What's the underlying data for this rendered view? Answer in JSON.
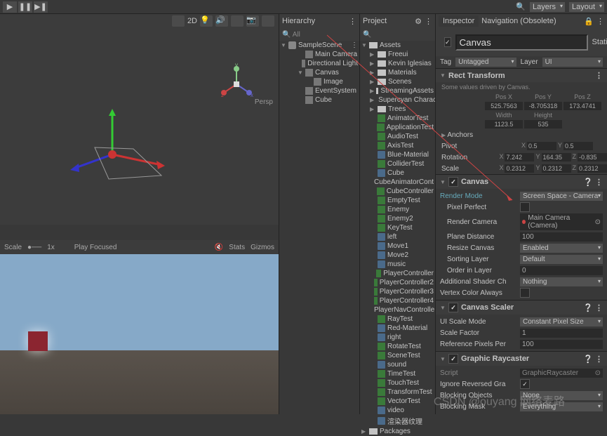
{
  "topbar": {
    "layers": "Layers",
    "layout": "Layout"
  },
  "hierarchy": {
    "title": "Hierarchy",
    "search": "All",
    "scene": "SampleScene",
    "items": [
      {
        "name": "Main Camera",
        "indent": 2
      },
      {
        "name": "Directional Light",
        "indent": 2
      },
      {
        "name": "Canvas",
        "indent": 2,
        "fold": true
      },
      {
        "name": "Image",
        "indent": 3
      },
      {
        "name": "EventSystem",
        "indent": 2
      },
      {
        "name": "Cube",
        "indent": 2
      }
    ]
  },
  "project": {
    "title": "Project",
    "root": "Assets",
    "items": [
      {
        "name": "Freeui",
        "type": "folder"
      },
      {
        "name": "Kevin Iglesias",
        "type": "folder"
      },
      {
        "name": "Materials",
        "type": "folder"
      },
      {
        "name": "Scenes",
        "type": "folder"
      },
      {
        "name": "StreamingAssets",
        "type": "folder"
      },
      {
        "name": "Supercyan Charac",
        "type": "folder"
      },
      {
        "name": "Trees",
        "type": "folder"
      },
      {
        "name": "AnimatorTest",
        "type": "cs"
      },
      {
        "name": "ApplicationTest",
        "type": "cs"
      },
      {
        "name": "AudioTest",
        "type": "cs"
      },
      {
        "name": "AxisTest",
        "type": "cs"
      },
      {
        "name": "Blue-Material",
        "type": "asset"
      },
      {
        "name": "ColliderTest",
        "type": "cs"
      },
      {
        "name": "Cube",
        "type": "asset"
      },
      {
        "name": "CubeAnimatorCont",
        "type": "asset"
      },
      {
        "name": "CubeController",
        "type": "cs"
      },
      {
        "name": "EmptyTest",
        "type": "cs"
      },
      {
        "name": "Enemy",
        "type": "cs"
      },
      {
        "name": "Enemy2",
        "type": "cs"
      },
      {
        "name": "KeyTest",
        "type": "cs"
      },
      {
        "name": "left",
        "type": "asset"
      },
      {
        "name": "Move1",
        "type": "asset"
      },
      {
        "name": "Move2",
        "type": "asset"
      },
      {
        "name": "music",
        "type": "asset"
      },
      {
        "name": "PlayerController",
        "type": "cs"
      },
      {
        "name": "PlayerController2",
        "type": "cs"
      },
      {
        "name": "PlayerController3",
        "type": "cs"
      },
      {
        "name": "PlayerController4",
        "type": "cs"
      },
      {
        "name": "PlayerNavControlle",
        "type": "cs"
      },
      {
        "name": "RayTest",
        "type": "cs"
      },
      {
        "name": "Red-Material",
        "type": "asset"
      },
      {
        "name": "right",
        "type": "asset"
      },
      {
        "name": "RotateTest",
        "type": "cs"
      },
      {
        "name": "SceneTest",
        "type": "cs"
      },
      {
        "name": "sound",
        "type": "asset"
      },
      {
        "name": "TimeTest",
        "type": "cs"
      },
      {
        "name": "TouchTest",
        "type": "cs"
      },
      {
        "name": "TransformTest",
        "type": "cs"
      },
      {
        "name": "VectorTest",
        "type": "cs"
      },
      {
        "name": "video",
        "type": "asset"
      },
      {
        "name": "渲染器纹理",
        "type": "asset"
      }
    ],
    "packages": "Packages"
  },
  "inspector": {
    "tab1": "Inspector",
    "tab2": "Navigation (Obsolete)",
    "name": "Canvas",
    "static": "Static",
    "tag_label": "Tag",
    "tag": "Untagged",
    "layer_label": "Layer",
    "layer": "UI",
    "rect": {
      "title": "Rect Transform",
      "note": "Some values driven by Canvas.",
      "posx_l": "Pos X",
      "posy_l": "Pos Y",
      "posz_l": "Pos Z",
      "posx": "525.7563",
      "posy": "-8.705318",
      "posz": "173.4741",
      "w_l": "Width",
      "h_l": "Height",
      "w": "1123.5",
      "h": "535",
      "anchors": "Anchors",
      "pivot": "Pivot",
      "px": "0.5",
      "py": "0.5",
      "rotation": "Rotation",
      "rx": "7.242",
      "ry": "164.35",
      "rz": "-0.835",
      "scale": "Scale",
      "sx": "0.2312",
      "sy": "0.2312",
      "sz": "0.2312"
    },
    "canvas": {
      "title": "Canvas",
      "render_mode_l": "Render Mode",
      "render_mode": "Screen Space - Camera",
      "pixel_perfect": "Pixel Perfect",
      "render_camera_l": "Render Camera",
      "render_camera": "Main Camera (Camera)",
      "plane_dist_l": "Plane Distance",
      "plane_dist": "100",
      "resize_l": "Resize Canvas",
      "resize": "Enabled",
      "sort_layer_l": "Sorting Layer",
      "sort_layer": "Default",
      "order_l": "Order in Layer",
      "order": "0",
      "shader_l": "Additional Shader Ch",
      "shader": "Nothing",
      "vertex_color": "Vertex Color Always"
    },
    "scaler": {
      "title": "Canvas Scaler",
      "mode_l": "UI Scale Mode",
      "mode": "Constant Pixel Size",
      "factor_l": "Scale Factor",
      "factor": "1",
      "ref_l": "Reference Pixels Per",
      "ref": "100"
    },
    "raycaster": {
      "title": "Graphic Raycaster",
      "script_l": "Script",
      "script": "GraphicRaycaster",
      "ignore_l": "Ignore Reversed Gra",
      "blocking_l": "Blocking Objects",
      "blocking": "None",
      "mask_l": "Blocking Mask",
      "mask": "Everything"
    }
  },
  "scene": {
    "twod": "2D",
    "persp": "Persp"
  },
  "game": {
    "scale": "Scale",
    "scale_val": "1x",
    "play_focused": "Play Focused",
    "stats": "Stats",
    "gizmos": "Gizmos"
  },
  "watermark": "CSDN @ouyang 网络麦路"
}
